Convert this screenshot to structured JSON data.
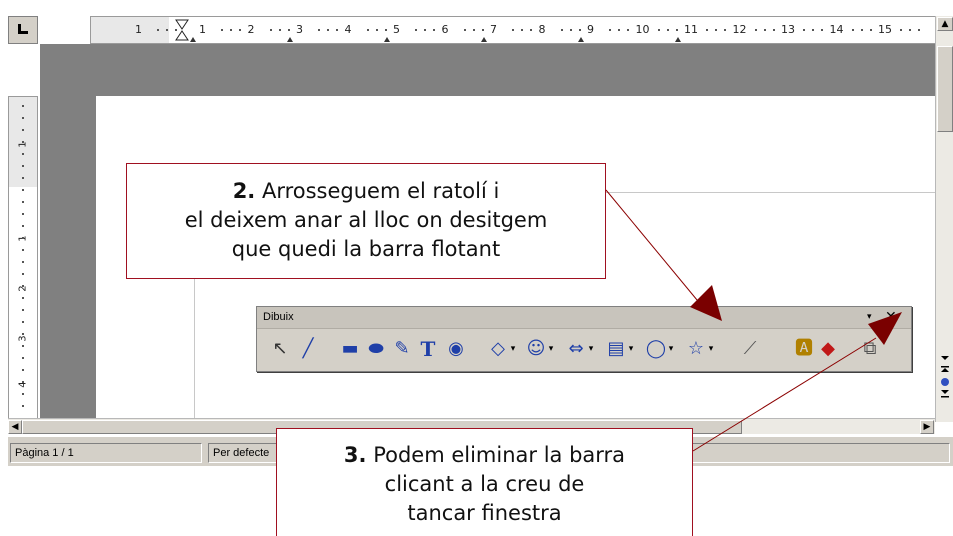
{
  "ruler": {
    "numbers": [
      "1",
      "1",
      "2",
      "3",
      "4",
      "5",
      "6",
      "7",
      "8",
      "9",
      "10",
      "11",
      "12",
      "13",
      "14",
      "15"
    ],
    "vertical_numbers": [
      "1",
      "1",
      "2",
      "3",
      "4"
    ]
  },
  "status_bar": {
    "page": "Pàgina  1 / 1",
    "style": "Per defecte"
  },
  "toolbar": {
    "title": "Dibuix",
    "menu_glyph": "▾",
    "close_glyph": "✕",
    "icons": [
      {
        "name": "select-icon",
        "glyph": "↖"
      },
      {
        "name": "line-icon",
        "glyph": "╱"
      },
      {
        "name": "rectangle-icon",
        "glyph": "▬"
      },
      {
        "name": "ellipse-icon",
        "glyph": "⬬"
      },
      {
        "name": "freeform-icon",
        "glyph": "✎"
      },
      {
        "name": "text-icon",
        "glyph": "T"
      },
      {
        "name": "callout-text-icon",
        "glyph": "◉"
      },
      {
        "name": "basic-shapes-icon",
        "glyph": "◇"
      },
      {
        "name": "symbol-shapes-icon",
        "glyph": "☺"
      },
      {
        "name": "block-arrows-icon",
        "glyph": "⇔"
      },
      {
        "name": "flowchart-icon",
        "glyph": "▤"
      },
      {
        "name": "callouts-icon",
        "glyph": "◯"
      },
      {
        "name": "stars-icon",
        "glyph": "☆"
      },
      {
        "name": "points-icon",
        "glyph": "⟋"
      },
      {
        "name": "fontwork-icon",
        "glyph": "🅰"
      },
      {
        "name": "extrusion-icon",
        "glyph": "◆"
      },
      {
        "name": "more-controls-icon",
        "glyph": "⧉"
      }
    ],
    "colors": {
      "bar": "#d4d0c8",
      "title_bar": "#c8c4bc",
      "icon_blue": "#1f3fa8",
      "icon_red": "#c01818"
    }
  },
  "callouts": {
    "step2": {
      "number": "2.",
      "line1": " Arrosseguem el ratolí i",
      "line2": "el deixem anar al lloc on desitgem",
      "line3": "que quedi la barra flotant"
    },
    "step3": {
      "number": "3.",
      "line1": " Podem eliminar la barra",
      "line2": "clicant a la creu de",
      "line3": "tancar finestra"
    },
    "colors": {
      "border": "#a01020",
      "arrow": "#8b0000"
    }
  }
}
